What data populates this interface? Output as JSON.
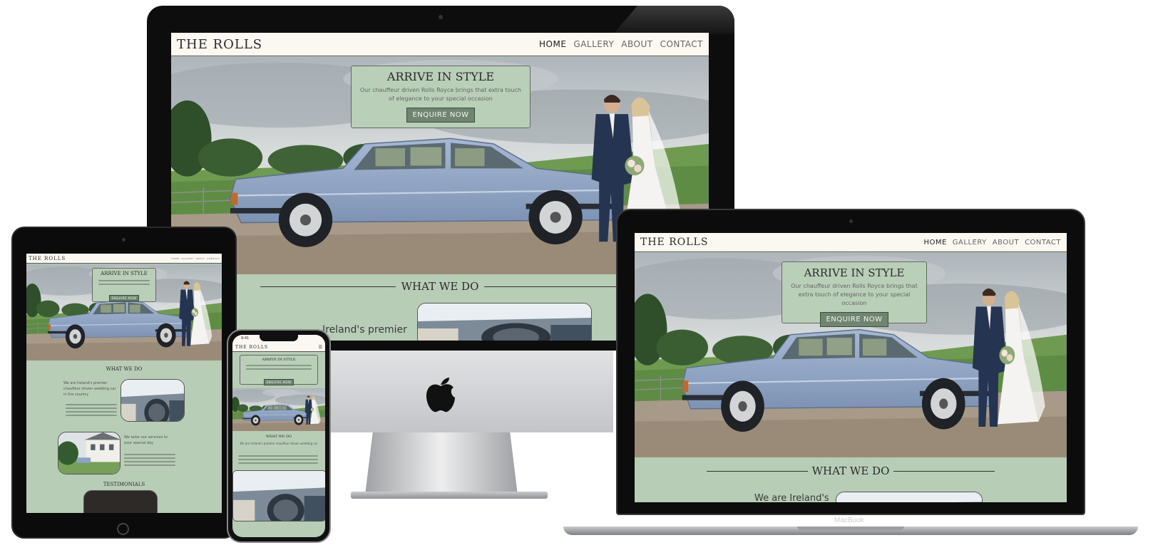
{
  "site": {
    "brand": "THE ROLLS",
    "nav": [
      "HOME",
      "GALLERY",
      "ABOUT",
      "CONTACT"
    ],
    "hero": {
      "title": "ARRIVE IN STYLE",
      "subtitle_desktop": "Our chauffeur driven Rolls Royce brings that extra touch of elegance to your special occasion",
      "subtitle_laptop": "Our chauffeur driven Rolls Royce brings that extra touch of elegance to your special occasion",
      "button": "ENQUIRE NOW"
    },
    "section_title": "WHAT WE DO",
    "intro_desktop": "Ireland's premier",
    "intro_laptop": "We are Ireland's",
    "tablet_intro": "We are Ireland's premier chauffeur driven wedding car in the country",
    "tablet_second": "We tailor our services to your special day",
    "testimonials": "TESTIMONIALS",
    "phone_time": "9:41",
    "phone_intro": "We are Ireland's premier chauffeur driven wedding car"
  },
  "devices": {
    "laptop_label": "MacBook"
  },
  "colors": {
    "sage": "#b7cdb6",
    "button": "#6f8570",
    "nav_bg": "#fbf7f1",
    "car": "#8ea4c4"
  }
}
